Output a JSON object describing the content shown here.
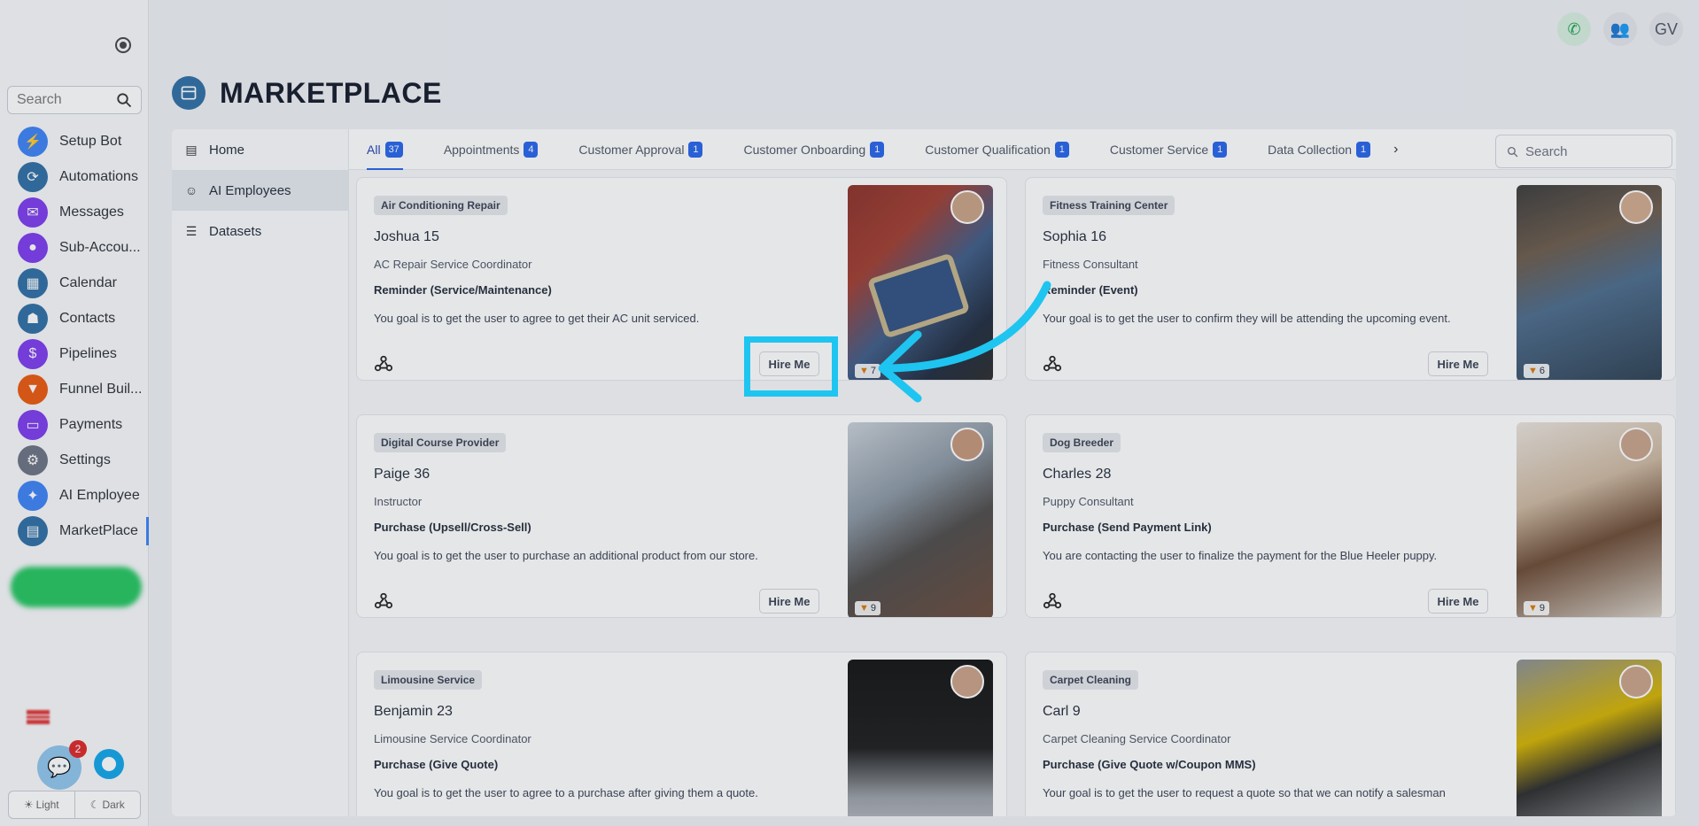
{
  "nav": {
    "search_placeholder": "Search",
    "items": [
      {
        "label": "Setup Bot",
        "icon": "lightning-icon",
        "color": "#3b82f6"
      },
      {
        "label": "Automations",
        "icon": "automation-icon",
        "color": "#2d6ea3"
      },
      {
        "label": "Messages",
        "icon": "chat-icon",
        "color": "#7c3aed"
      },
      {
        "label": "Sub-Accou...",
        "icon": "user-icon",
        "color": "#7c3aed"
      },
      {
        "label": "Calendar",
        "icon": "calendar-icon",
        "color": "#2d6ea3"
      },
      {
        "label": "Contacts",
        "icon": "contacts-icon",
        "color": "#2d6ea3"
      },
      {
        "label": "Pipelines",
        "icon": "dollar-icon",
        "color": "#7c3aed"
      },
      {
        "label": "Funnel Buil...",
        "icon": "funnel-icon",
        "color": "#ea580c"
      },
      {
        "label": "Payments",
        "icon": "card-icon",
        "color": "#7c3aed"
      },
      {
        "label": "Settings",
        "icon": "gear-icon",
        "color": "#6b7280"
      },
      {
        "label": "AI Employee",
        "icon": "bulb-icon",
        "color": "#3b82f6"
      },
      {
        "label": "MarketPlace",
        "icon": "store-icon",
        "color": "#2d6ea3"
      }
    ],
    "chat_badge": "2",
    "theme_light": "Light",
    "theme_dark": "Dark"
  },
  "header": {
    "avatar_initials": "GV"
  },
  "page": {
    "title": "MARKETPLACE"
  },
  "subnav": [
    {
      "label": "Home",
      "icon": "store-icon"
    },
    {
      "label": "AI Employees",
      "icon": "robot-icon"
    },
    {
      "label": "Datasets",
      "icon": "list-icon"
    }
  ],
  "tabs": [
    {
      "label": "All",
      "count": "37"
    },
    {
      "label": "Appointments",
      "count": "4"
    },
    {
      "label": "Customer Approval",
      "count": "1"
    },
    {
      "label": "Customer Onboarding",
      "count": "1"
    },
    {
      "label": "Customer Qualification",
      "count": "1"
    },
    {
      "label": "Customer Service",
      "count": "1"
    },
    {
      "label": "Data Collection",
      "count": "1"
    }
  ],
  "tab_search_placeholder": "Search",
  "hire_label": "Hire Me",
  "cards": [
    {
      "category": "Air Conditioning Repair",
      "name": "Joshua 15",
      "role": "AC Repair Service Coordinator",
      "use_case": "Reminder (Service/Maintenance)",
      "goal": "You goal is to get the user to agree to get their AC unit serviced.",
      "rating": "7"
    },
    {
      "category": "Fitness Training Center",
      "name": "Sophia 16",
      "role": "Fitness Consultant",
      "use_case": "Reminder (Event)",
      "goal": "Your goal is to get the user to confirm they will be attending the upcoming event.",
      "rating": "6"
    },
    {
      "category": "Digital Course Provider",
      "name": "Paige 36",
      "role": "Instructor",
      "use_case": "Purchase (Upsell/Cross-Sell)",
      "goal": "You goal is to get the user to purchase an additional product from our store.",
      "rating": "9"
    },
    {
      "category": "Dog Breeder",
      "name": "Charles 28",
      "role": "Puppy Consultant",
      "use_case": "Purchase (Send Payment Link)",
      "goal": "You are contacting the user to finalize the payment for the Blue Heeler puppy.",
      "rating": "9"
    },
    {
      "category": "Limousine Service",
      "name": "Benjamin 23",
      "role": "Limousine Service Coordinator",
      "use_case": "Purchase (Give Quote)",
      "goal": "You goal is to get the user to agree to a purchase after giving them a quote.",
      "rating": ""
    },
    {
      "category": "Carpet Cleaning",
      "name": "Carl 9",
      "role": "Carpet Cleaning Service Coordinator",
      "use_case": "Purchase (Give Quote w/Coupon MMS)",
      "goal": "Your goal is to get the user to request a quote so that we can notify a salesman",
      "rating": ""
    }
  ],
  "colors": {
    "accent": "#2563eb",
    "highlight": "#1ec5f0"
  }
}
